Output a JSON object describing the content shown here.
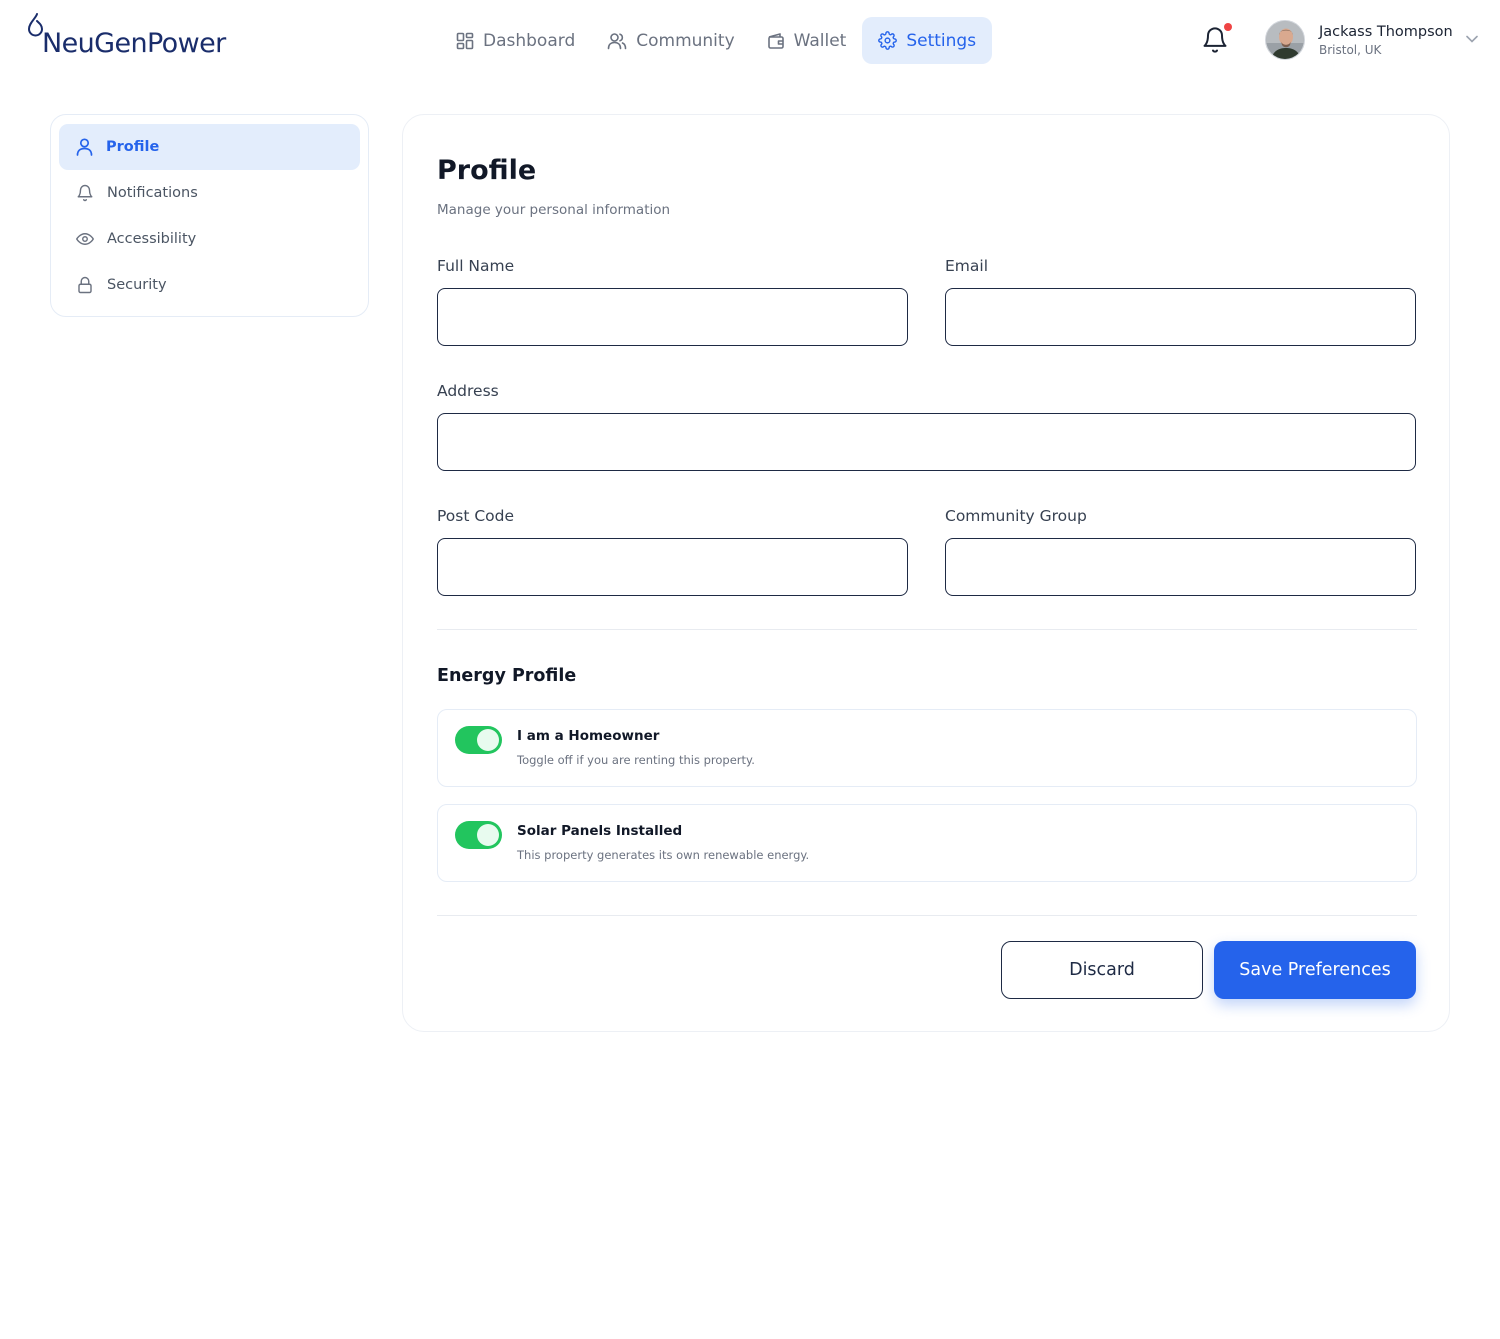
{
  "brand": {
    "name": "NeuGenPower",
    "color": "#1a2d6b"
  },
  "nav": {
    "items": [
      {
        "label": "Dashboard",
        "icon": "grid-icon"
      },
      {
        "label": "Community",
        "icon": "users-icon"
      },
      {
        "label": "Wallet",
        "icon": "wallet-icon"
      },
      {
        "label": "Settings",
        "icon": "gear-icon",
        "active": true
      }
    ]
  },
  "notifications": {
    "icon": "bell-icon",
    "has_unread": true,
    "dot_color": "#ef4444"
  },
  "user": {
    "name": "Jackass Thompson",
    "location": "Bristol, UK"
  },
  "sidebar": {
    "items": [
      {
        "label": "Profile",
        "icon": "user-icon",
        "active": true
      },
      {
        "label": "Notifications",
        "icon": "bell-icon"
      },
      {
        "label": "Accessibility",
        "icon": "eye-icon"
      },
      {
        "label": "Security",
        "icon": "lock-icon"
      }
    ]
  },
  "profile": {
    "title": "Profile",
    "subtitle": "Manage your personal information",
    "fields": {
      "full_name": {
        "label": "Full Name",
        "value": ""
      },
      "email": {
        "label": "Email",
        "value": ""
      },
      "address": {
        "label": "Address",
        "value": ""
      },
      "post_code": {
        "label": "Post Code",
        "value": ""
      },
      "community_group": {
        "label": "Community Group",
        "value": ""
      }
    }
  },
  "energy": {
    "title": "Energy Profile",
    "toggles": [
      {
        "title": "I am a Homeowner",
        "description": "Toggle off if you are renting this property.",
        "on": true
      },
      {
        "title": "Solar Panels Installed",
        "description": "This property generates its own renewable energy.",
        "on": true
      }
    ]
  },
  "actions": {
    "discard_label": "Discard",
    "save_label": "Save Preferences"
  },
  "colors": {
    "accent": "#2563eb",
    "accent_soft": "#e3edfc",
    "toggle_on": "#22c55e"
  }
}
